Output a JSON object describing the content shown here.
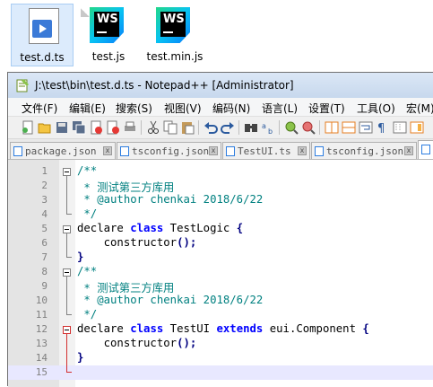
{
  "desktop": {
    "icons": [
      {
        "name": "test.d.ts",
        "type": "media-file",
        "selected": true
      },
      {
        "name": "test.js",
        "type": "webstorm"
      },
      {
        "name": "test.min.js",
        "type": "webstorm"
      }
    ]
  },
  "ws_logo_text": "WS",
  "window": {
    "title": "J:\\test\\bin\\test.d.ts - Notepad++ [Administrator]"
  },
  "menu": [
    "文件(F)",
    "编辑(E)",
    "搜索(S)",
    "视图(V)",
    "编码(N)",
    "语言(L)",
    "设置(T)",
    "工具(O)",
    "宏(M)"
  ],
  "tabs": [
    {
      "label": "package.json",
      "active": false
    },
    {
      "label": "tsconfig.json",
      "active": false
    },
    {
      "label": "TestUI.ts",
      "active": false
    },
    {
      "label": "tsconfig.json",
      "active": false
    }
  ],
  "tab_close_glyph": "x",
  "editor": {
    "current_line": 15,
    "lines": [
      {
        "n": "1",
        "tokens": [
          {
            "t": "/**",
            "c": "cm"
          }
        ]
      },
      {
        "n": "2",
        "tokens": [
          {
            "t": " * 测试第三方库用",
            "c": "cm"
          }
        ]
      },
      {
        "n": "3",
        "tokens": [
          {
            "t": " * @author chenkai 2018/6/22",
            "c": "cm"
          }
        ]
      },
      {
        "n": "4",
        "tokens": [
          {
            "t": " */",
            "c": "cm"
          }
        ]
      },
      {
        "n": "5",
        "tokens": [
          {
            "t": "declare ",
            "c": "kw"
          },
          {
            "t": "class",
            "c": "kw-b"
          },
          {
            "t": " TestLogic ",
            "c": "id"
          },
          {
            "t": "{",
            "c": "op"
          }
        ]
      },
      {
        "n": "6",
        "tokens": [
          {
            "t": "    constructor",
            "c": "id"
          },
          {
            "t": "();",
            "c": "op"
          }
        ]
      },
      {
        "n": "7",
        "tokens": [
          {
            "t": "}",
            "c": "op"
          }
        ]
      },
      {
        "n": "8",
        "tokens": [
          {
            "t": "/**",
            "c": "cm"
          }
        ]
      },
      {
        "n": "9",
        "tokens": [
          {
            "t": " * 测试第三方库用",
            "c": "cm"
          }
        ]
      },
      {
        "n": "10",
        "tokens": [
          {
            "t": " * @author chenkai 2018/6/22",
            "c": "cm"
          }
        ]
      },
      {
        "n": "11",
        "tokens": [
          {
            "t": " */",
            "c": "cm"
          }
        ]
      },
      {
        "n": "12",
        "tokens": [
          {
            "t": "declare ",
            "c": "kw"
          },
          {
            "t": "class",
            "c": "kw-b"
          },
          {
            "t": " TestUI ",
            "c": "id"
          },
          {
            "t": "extends",
            "c": "kw-b"
          },
          {
            "t": " eui.Component ",
            "c": "id"
          },
          {
            "t": "{",
            "c": "op"
          }
        ]
      },
      {
        "n": "13",
        "tokens": [
          {
            "t": "    constructor",
            "c": "id"
          },
          {
            "t": "();",
            "c": "op"
          }
        ]
      },
      {
        "n": "14",
        "tokens": [
          {
            "t": "}",
            "c": "op"
          }
        ]
      },
      {
        "n": "15",
        "tokens": []
      }
    ]
  },
  "colors": {
    "comment": "#008080",
    "keyword": "#0000ff",
    "operator": "#000080",
    "current_line": "#e8e8ff"
  }
}
